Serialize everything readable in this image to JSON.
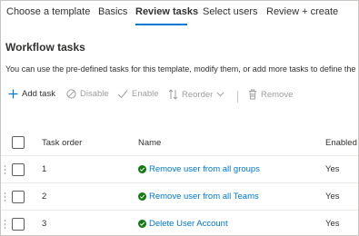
{
  "tabs": [
    {
      "label": "Choose a template"
    },
    {
      "label": "Basics"
    },
    {
      "label": "Review tasks"
    },
    {
      "label": "Select users"
    },
    {
      "label": "Review + create"
    }
  ],
  "section": {
    "title": "Workflow tasks",
    "description": "You can use the pre-defined tasks for this template, modify them, or add more tasks to define the"
  },
  "toolbar": {
    "add_task": "Add task",
    "disable": "Disable",
    "enable": "Enable",
    "reorder": "Reorder",
    "remove": "Remove"
  },
  "table": {
    "columns": {
      "task_order": "Task order",
      "name": "Name",
      "enabled": "Enabled"
    },
    "rows": [
      {
        "order": "1",
        "name": "Remove user from all groups",
        "enabled": "Yes"
      },
      {
        "order": "2",
        "name": "Remove user from all Teams",
        "enabled": "Yes"
      },
      {
        "order": "3",
        "name": "Delete User Account",
        "enabled": "Yes"
      }
    ]
  },
  "colors": {
    "accent": "#0078d4",
    "success": "#107c10",
    "disabled": "#a19f9d"
  },
  "icons": [
    "plus-icon",
    "disable-icon",
    "checkmark-icon",
    "reorder-icon",
    "chevron-down-icon",
    "trash-icon",
    "drag-handle-icon",
    "success-icon"
  ]
}
